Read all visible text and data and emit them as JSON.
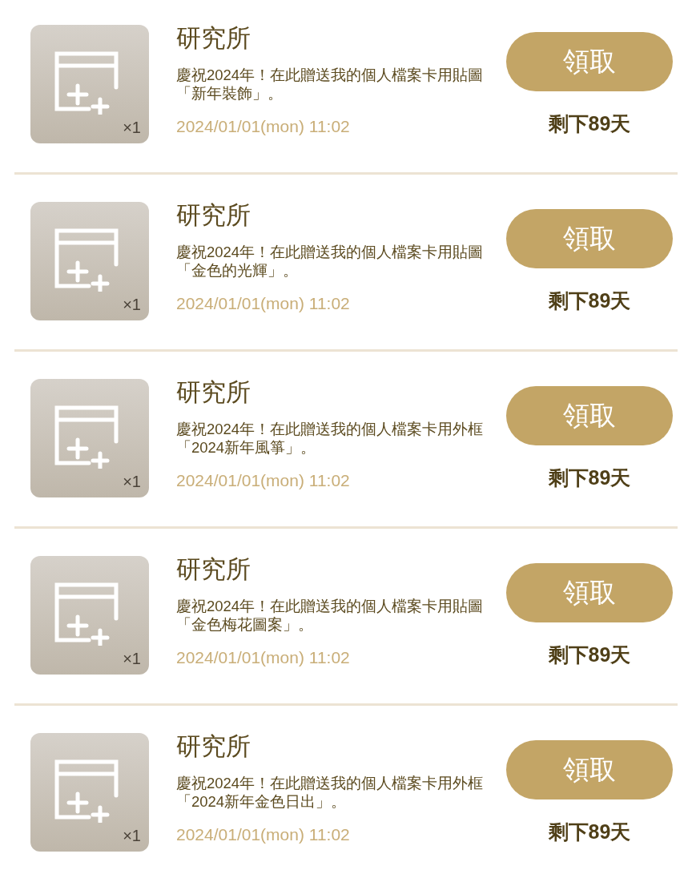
{
  "gifts": [
    {
      "sender": "研究所",
      "message": "慶祝2024年！在此贈送我的個人檔案卡用貼圖「新年裝飾」。",
      "date": "2024/01/01(mon) 11:02",
      "quantity": "×1",
      "button": "領取",
      "remaining": "剩下89天"
    },
    {
      "sender": "研究所",
      "message": "慶祝2024年！在此贈送我的個人檔案卡用貼圖「金色的光輝」。",
      "date": "2024/01/01(mon) 11:02",
      "quantity": "×1",
      "button": "領取",
      "remaining": "剩下89天"
    },
    {
      "sender": "研究所",
      "message": "慶祝2024年！在此贈送我的個人檔案卡用外框「2024新年風箏」。",
      "date": "2024/01/01(mon) 11:02",
      "quantity": "×1",
      "button": "領取",
      "remaining": "剩下89天"
    },
    {
      "sender": "研究所",
      "message": "慶祝2024年！在此贈送我的個人檔案卡用貼圖「金色梅花圖案」。",
      "date": "2024/01/01(mon) 11:02",
      "quantity": "×1",
      "button": "領取",
      "remaining": "剩下89天"
    },
    {
      "sender": "研究所",
      "message": "慶祝2024年！在此贈送我的個人檔案卡用外框「2024新年金色日出」。",
      "date": "2024/01/01(mon) 11:02",
      "quantity": "×1",
      "button": "領取",
      "remaining": "剩下89天"
    }
  ]
}
